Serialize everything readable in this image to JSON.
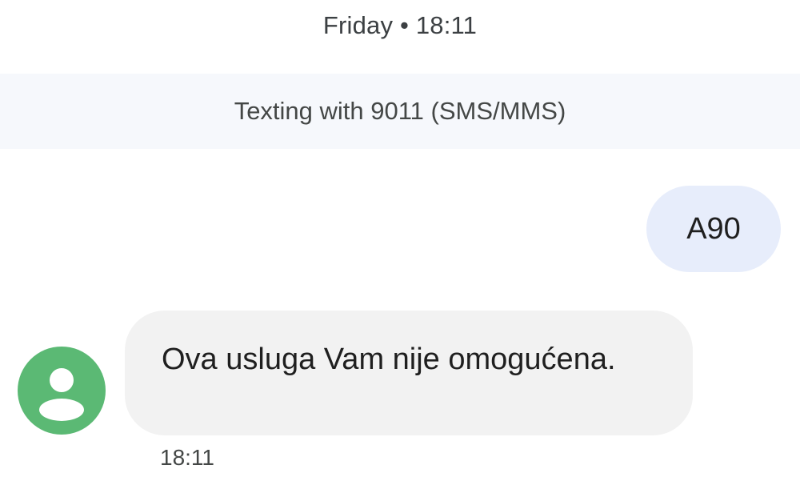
{
  "header": {
    "date_label": "Friday • 18:11"
  },
  "banner": {
    "text": "Texting with 9011 (SMS/MMS)"
  },
  "messages": [
    {
      "direction": "outgoing",
      "text": "A90"
    },
    {
      "direction": "incoming",
      "text": "Ova usluga Vam nije omogućena.",
      "time": "18:11",
      "avatar_icon": "person-icon"
    }
  ],
  "colors": {
    "outgoing_bubble": "#e7edfb",
    "incoming_bubble": "#f2f2f2",
    "avatar": "#5bb974",
    "banner_bg": "#f6f8fc"
  }
}
